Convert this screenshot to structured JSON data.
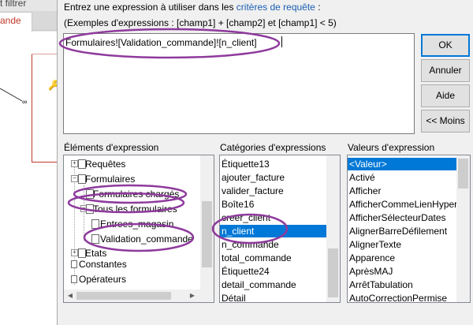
{
  "background": {
    "filter_label": "t filtrer",
    "tab_label": "ande",
    "key_glyph": "🔑"
  },
  "dialog": {
    "prompt_before": "Entrez une expression à utiliser dans les ",
    "prompt_link": "critères de requête",
    "prompt_after": " :",
    "examples": "(Exemples d'expressions : [champ1] + [champ2] et [champ1] < 5)",
    "expression": "Formulaires![Validation_commande]![n_client]"
  },
  "buttons": {
    "ok": "OK",
    "annuler": "Annuler",
    "aide": "Aide",
    "moins": "<< Moins"
  },
  "panels": {
    "elements_header": "Éléments d'expression",
    "categories_header": "Catégories d'expressions",
    "valeurs_header": "Valeurs d'expression",
    "elements": [
      "Requêtes",
      "Formulaires",
      "Formulaires chargés",
      "Tous les formulaires",
      "Entrees_magasin",
      "Validation_commande",
      "Etats",
      "Constantes",
      "Opérateurs"
    ],
    "categories": [
      "Étiquette13",
      "ajouter_facture",
      "valider_facture",
      "Boîte16",
      "creer_client",
      "n_client",
      "n_commande",
      "total_commande",
      "Étiquette24",
      "detail_commande",
      "Détail"
    ],
    "selected_category": "n_client",
    "valeurs": [
      "<Valeur>",
      "Activé",
      "Afficher",
      "AfficherCommeLienHyper",
      "AfficherSélecteurDates",
      "AlignerBarreDéfilement",
      "AlignerTexte",
      "Apparence",
      "AprèsMAJ",
      "ArrêtTabulation",
      "AutoCorrectionPermise"
    ],
    "selected_valeur": "<Valeur>"
  },
  "colors": {
    "selection": "#0078d7",
    "annotation": "#8e3a9d",
    "link": "#1a5fb4"
  }
}
